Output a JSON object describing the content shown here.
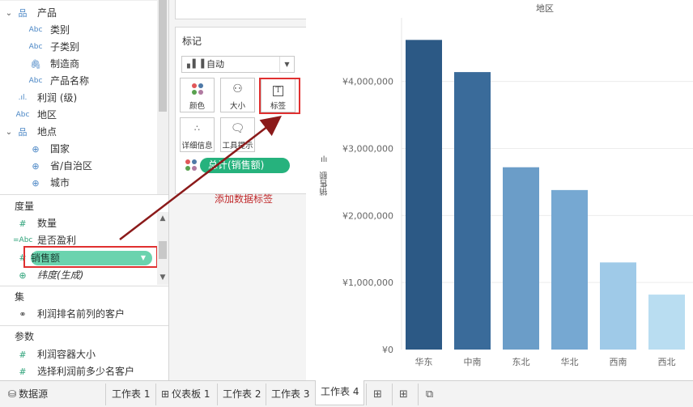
{
  "data_pane": {
    "dimensions": [
      {
        "name": "产品",
        "kind": "hierarchy",
        "icon": "hierarchy-icon",
        "expanded": true
      },
      {
        "name": "类别",
        "kind": "abc",
        "icon": "string-field-icon"
      },
      {
        "name": "子类别",
        "kind": "abc",
        "icon": "string-field-icon"
      },
      {
        "name": "制造商",
        "kind": "clip",
        "icon": "paperclip-icon"
      },
      {
        "name": "产品名称",
        "kind": "abc",
        "icon": "string-field-icon"
      },
      {
        "name": "利润 (级)",
        "kind": "bin",
        "icon": "bin-field-icon"
      },
      {
        "name": "地区",
        "kind": "abc",
        "icon": "string-field-icon"
      },
      {
        "name": "地点",
        "kind": "hierarchy",
        "icon": "hierarchy-icon",
        "expanded": true
      },
      {
        "name": "国家",
        "kind": "globe",
        "icon": "globe-icon"
      },
      {
        "name": "省/自治区",
        "kind": "globe",
        "icon": "globe-icon"
      },
      {
        "name": "城市",
        "kind": "globe",
        "icon": "globe-icon"
      }
    ],
    "measures_title": "度量",
    "measures": [
      {
        "name": "数量",
        "kind": "hash",
        "icon": "number-field-icon"
      },
      {
        "name": "是否盈利",
        "kind": "calc-abc",
        "icon": "calc-string-field-icon"
      },
      {
        "name": "销售额",
        "kind": "hash",
        "icon": "number-field-icon",
        "selected": true
      },
      {
        "name": "纬度(生成)",
        "kind": "globe",
        "icon": "globe-icon"
      }
    ],
    "sets_title": "集",
    "sets": [
      {
        "name": "利润排名前列的客户",
        "icon": "set-icon"
      }
    ],
    "params_title": "参数",
    "params": [
      {
        "name": "利润容器大小",
        "icon": "number-field-icon"
      },
      {
        "name": "选择利润前多少名客户",
        "icon": "number-field-icon"
      }
    ]
  },
  "marks": {
    "title": "标记",
    "mark_type": "自动",
    "buttons": [
      {
        "label": "颜色",
        "icon": "color-icon"
      },
      {
        "label": "大小",
        "icon": "size-icon"
      },
      {
        "label": "标签",
        "icon": "text-label-icon"
      },
      {
        "label": "详细信息",
        "icon": "detail-icon"
      },
      {
        "label": "工具提示",
        "icon": "tooltip-icon"
      }
    ],
    "color_pill": "总计(销售额)",
    "annotation": "添加数据标签"
  },
  "colors": {
    "highlight": "#e03030",
    "arrow": "#8b1a1a",
    "pill_green": "#26b27d",
    "pill_light_green": "#6bd3ae"
  },
  "chart_data": {
    "type": "bar",
    "title": "地区",
    "ylabel": "销售额",
    "categories": [
      "华东",
      "中南",
      "东北",
      "华北",
      "西南",
      "西北"
    ],
    "values": [
      4620000,
      4140000,
      2720000,
      2380000,
      1300000,
      820000
    ],
    "bar_colors": [
      "#2c5985",
      "#3a6b9a",
      "#6b9dc8",
      "#76a8d2",
      "#9fcae8",
      "#b9ddf1"
    ],
    "ylim": [
      0,
      4950000
    ],
    "yticks": [
      0,
      1000000,
      2000000,
      3000000,
      4000000
    ],
    "ytick_labels": [
      "¥0",
      "¥1,000,000",
      "¥2,000,000",
      "¥3,000,000",
      "¥4,000,000"
    ],
    "grid": true
  },
  "tabbar": {
    "datasource": "数据源",
    "tabs": [
      {
        "label": "工作表 1",
        "icon": ""
      },
      {
        "label": "仪表板 1",
        "icon": "dashboard-icon"
      },
      {
        "label": "工作表 2",
        "icon": ""
      },
      {
        "label": "工作表 3",
        "icon": ""
      },
      {
        "label": "工作表 4",
        "icon": "",
        "active": true
      }
    ]
  }
}
